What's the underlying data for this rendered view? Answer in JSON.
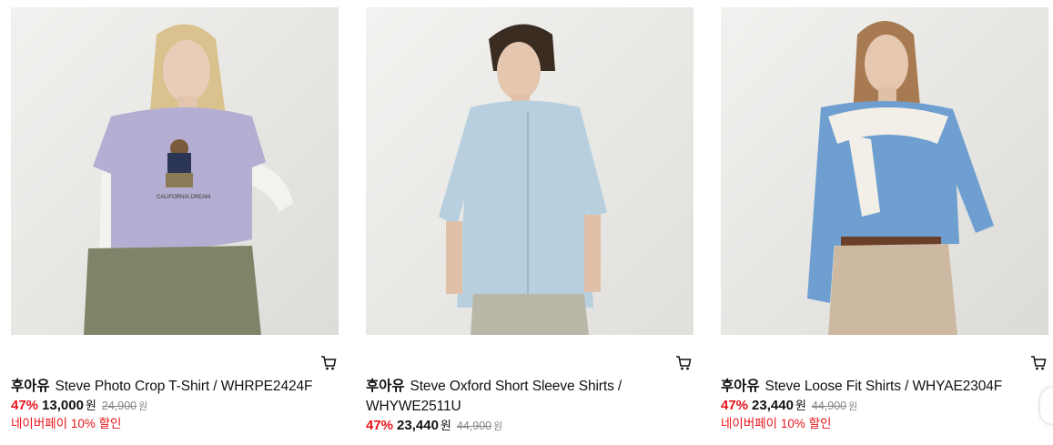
{
  "products": [
    {
      "brand": "후아유",
      "name": "Steve Photo Crop T-Shirt / WHRPE2424F",
      "discount": "47%",
      "price": "13,000",
      "currency": "원",
      "original_price": "24,900",
      "original_currency": "원",
      "promo": "네이버페이 10% 할인",
      "cart_icon": "cart-icon"
    },
    {
      "brand": "후아유",
      "name": "Steve Oxford Short Sleeve Shirts / WHYWE2511U",
      "discount": "47%",
      "price": "23,440",
      "currency": "원",
      "original_price": "44,900",
      "original_currency": "원",
      "cart_icon": "cart-icon"
    },
    {
      "brand": "후아유",
      "name": "Steve Loose Fit Shirts / WHYAE2304F",
      "discount": "47%",
      "price": "23,440",
      "currency": "원",
      "original_price": "44,900",
      "original_currency": "원",
      "promo": "네이버페이 10% 할인",
      "cart_icon": "cart-icon"
    }
  ],
  "colors": {
    "discount_red": "#e8141b",
    "promo_red": "#e8141b",
    "strike_gray": "#888888"
  }
}
